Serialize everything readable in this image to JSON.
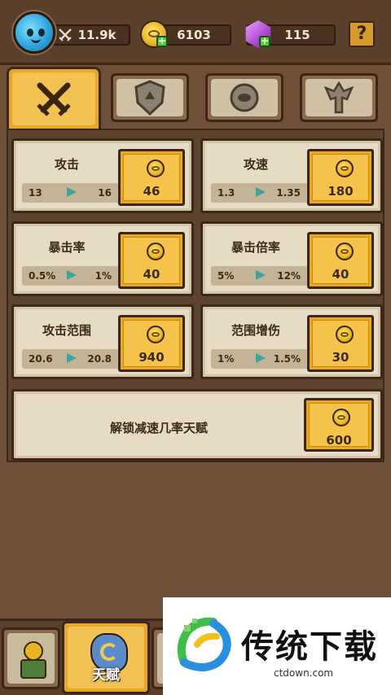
{
  "resources": {
    "power": "11.9k",
    "gold": "6103",
    "gems": "115",
    "help": "?"
  },
  "category_tabs": [
    {
      "icon": "crossed-swords-icon",
      "active": true
    },
    {
      "icon": "shield-icon",
      "active": false
    },
    {
      "icon": "round-token-icon",
      "active": false
    },
    {
      "icon": "demon-totem-icon",
      "active": false
    }
  ],
  "talents": [
    {
      "name": "攻击",
      "from": "13",
      "to": "16",
      "cost": "46"
    },
    {
      "name": "攻速",
      "from": "1.3",
      "to": "1.35",
      "cost": "180"
    },
    {
      "name": "暴击率",
      "from": "0.5%",
      "to": "1%",
      "cost": "40"
    },
    {
      "name": "暴击倍率",
      "from": "5%",
      "to": "12%",
      "cost": "40"
    },
    {
      "name": "攻击范围",
      "from": "20.6",
      "to": "20.8",
      "cost": "940"
    },
    {
      "name": "范围增伤",
      "from": "1%",
      "to": "1.5%",
      "cost": "30"
    }
  ],
  "unlock": {
    "text": "解锁减速几率天赋",
    "cost": "600"
  },
  "bottom_nav": {
    "talent_label": "天赋"
  },
  "watermark": {
    "title": "传统下载",
    "url": "ctdown.com"
  },
  "colors": {
    "accent_gold": "#e9a728",
    "card_bg": "#e6dcc6",
    "arrow": "#3aa5a0"
  }
}
